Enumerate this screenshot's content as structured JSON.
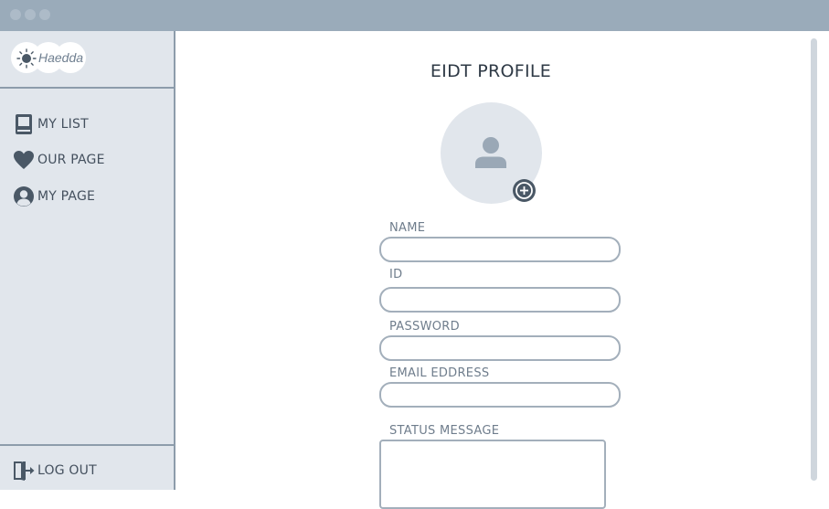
{
  "app": {
    "logo_text": "Haedda"
  },
  "sidebar": {
    "items": [
      {
        "label": "MY LIST",
        "icon": "book-icon"
      },
      {
        "label": "OUR PAGE",
        "icon": "heart-icon"
      },
      {
        "label": "MY PAGE",
        "icon": "user-circle-icon"
      }
    ],
    "logout_label": "LOG OUT",
    "logout_icon": "logout-door-icon"
  },
  "main": {
    "title": "EIDT PROFILE",
    "fields": {
      "name_label": "NAME",
      "id_label": "ID",
      "password_label": "PASSWORD",
      "email_label": "EMAIL EDDRESS",
      "status_label": "STATUS MESSAGE"
    },
    "avatar_icon": "user-avatar-icon",
    "add_photo_icon": "plus-circle-icon"
  },
  "colors": {
    "titlebar": "#9aabba",
    "sidebar_bg": "#e1e6ec",
    "border": "#8d9cab",
    "text_dark": "#44505e"
  }
}
